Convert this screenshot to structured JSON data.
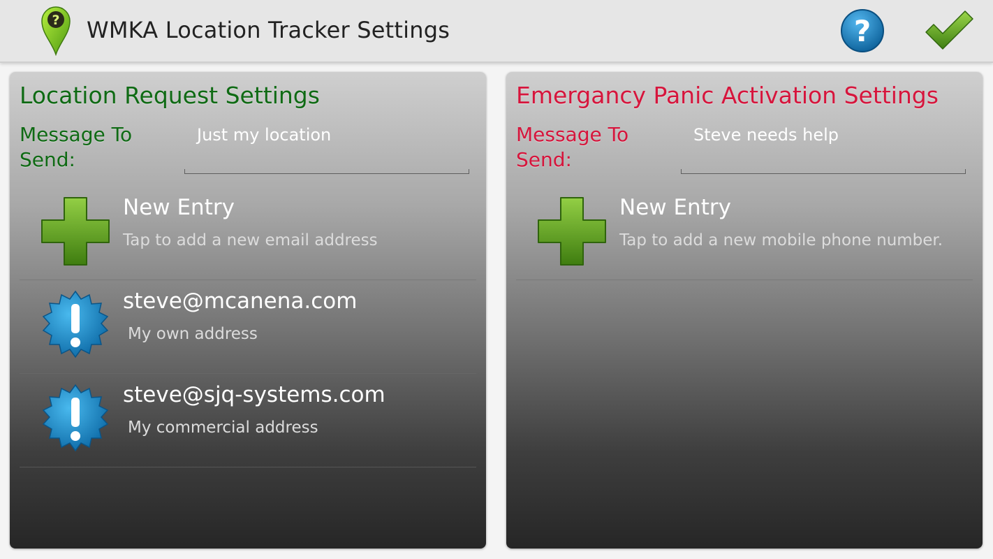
{
  "app": {
    "title": "WMKA Location Tracker Settings",
    "icons": {
      "app": "map-pin-question-icon",
      "help": "help-question-icon",
      "done": "checkmark-icon"
    }
  },
  "colors": {
    "location_accent": "#0f6a14",
    "panic_accent": "#d6153c",
    "help_blue": "#1a86c9",
    "check_green": "#6aa829"
  },
  "location": {
    "title": "Location Request Settings",
    "message_label_line1": "Message To",
    "message_label_line2": "Send:",
    "message_value": "Just my location",
    "new_entry": {
      "title": "New Entry",
      "subtitle": "Tap to add a new email address",
      "icon": "plus-icon"
    },
    "entries": [
      {
        "title": "steve@mcanena.com",
        "subtitle": "My own address",
        "icon": "alert-badge-icon"
      },
      {
        "title": "steve@sjq-systems.com",
        "subtitle": "My commercial address",
        "icon": "alert-badge-icon"
      }
    ]
  },
  "panic": {
    "title": "Emergancy Panic Activation Settings",
    "message_label_line1": "Message To",
    "message_label_line2": "Send:",
    "message_value": "Steve needs help",
    "new_entry": {
      "title": "New Entry",
      "subtitle": "Tap to add a new mobile phone number.",
      "icon": "plus-icon"
    }
  }
}
